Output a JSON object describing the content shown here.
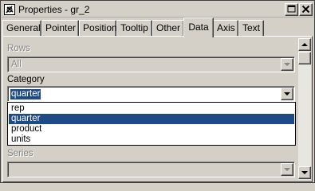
{
  "window": {
    "title": "Properties - gr_2"
  },
  "tabs": [
    {
      "label": "General"
    },
    {
      "label": "Pointer"
    },
    {
      "label": "Position"
    },
    {
      "label": "Tooltip"
    },
    {
      "label": "Other"
    },
    {
      "label": "Data",
      "active": true
    },
    {
      "label": "Axis"
    },
    {
      "label": "Text"
    }
  ],
  "fields": {
    "rows": {
      "label": "Rows",
      "value": "All",
      "disabled": true
    },
    "category": {
      "label": "Category",
      "value": "quarter",
      "options": [
        "rep",
        "quarter",
        "product",
        "units"
      ],
      "selected_option": "quarter"
    },
    "series": {
      "label": "Series",
      "value": "",
      "disabled": true
    }
  },
  "colors": {
    "selection": "#1e4a86",
    "face": "#d4d0c8",
    "disabled_text": "#868686"
  }
}
